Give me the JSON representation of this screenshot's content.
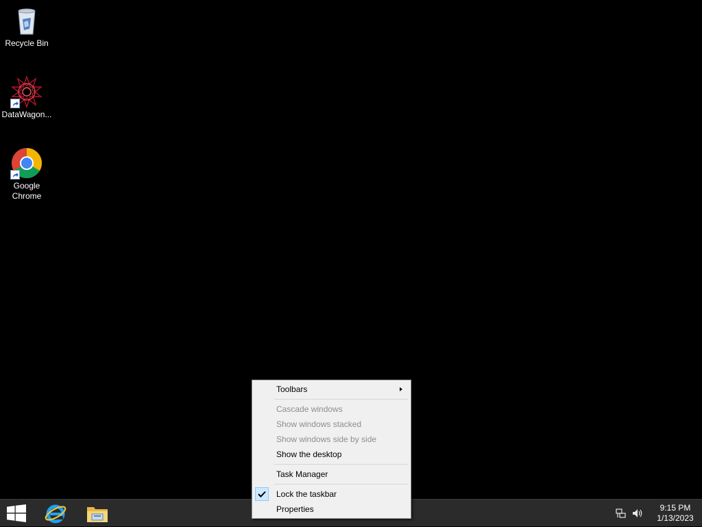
{
  "desktop": {
    "icons": [
      {
        "label": "Recycle Bin",
        "icon": "recycle-bin-icon"
      },
      {
        "label": "DataWagon...",
        "icon": "datawagon-icon"
      },
      {
        "label_line1": "Google",
        "label_line2": "Chrome",
        "icon": "chrome-icon"
      }
    ]
  },
  "context_menu": {
    "items": [
      {
        "label": "Toolbars",
        "enabled": true,
        "submenu": true
      },
      {
        "label": "Cascade windows",
        "enabled": false
      },
      {
        "label": "Show windows stacked",
        "enabled": false
      },
      {
        "label": "Show windows side by side",
        "enabled": false
      },
      {
        "label": "Show the desktop",
        "enabled": true
      },
      {
        "label": "Task Manager",
        "enabled": true
      },
      {
        "label": "Lock the taskbar",
        "enabled": true,
        "checked": true
      },
      {
        "label": "Properties",
        "enabled": true
      }
    ]
  },
  "taskbar": {
    "start_icon": "windows-logo-icon",
    "pinned": [
      {
        "icon": "internet-explorer-icon"
      },
      {
        "icon": "file-explorer-icon"
      }
    ],
    "tray": {
      "network_icon": "network-icon",
      "volume_icon": "volume-icon",
      "time": "9:15 PM",
      "date": "1/13/2023"
    }
  },
  "colors": {
    "desktop_bg": "#000000",
    "taskbar_bg": "#2b2b2b",
    "menu_bg": "#f0f0f0",
    "menu_disabled_text": "#8d8d8d",
    "check_highlight": "#cde8ff"
  }
}
